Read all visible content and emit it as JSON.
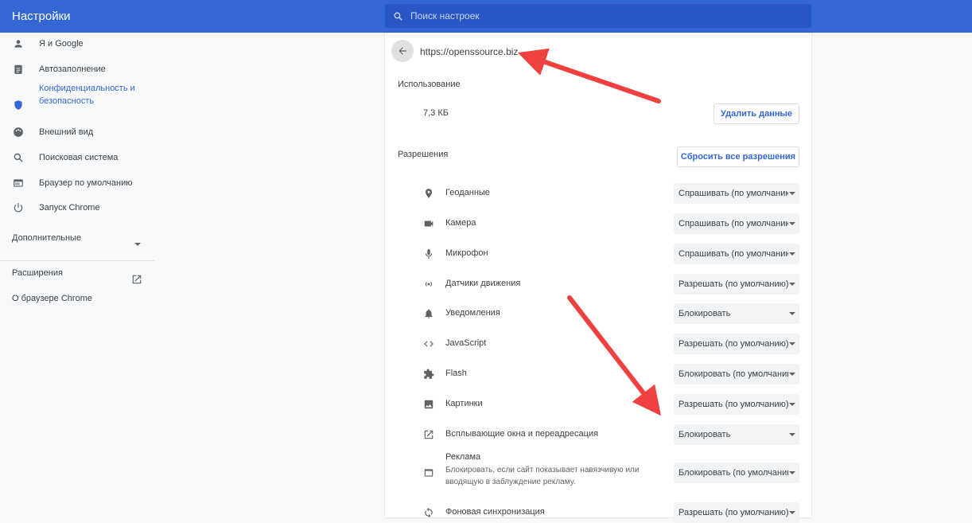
{
  "header": {
    "title": "Настройки",
    "search_placeholder": "Поиск настроек"
  },
  "sidebar": {
    "items": [
      {
        "label": "Я и Google",
        "icon": "person-icon"
      },
      {
        "label": "Автозаполнение",
        "icon": "clipboard-icon"
      },
      {
        "label": "Конфиденциальность и безопасность",
        "icon": "shield-icon",
        "active": true
      },
      {
        "label": "Внешний вид",
        "icon": "palette-icon"
      },
      {
        "label": "Поисковая система",
        "icon": "search-icon"
      },
      {
        "label": "Браузер по умолчанию",
        "icon": "browser-icon"
      },
      {
        "label": "Запуск Chrome",
        "icon": "power-icon"
      }
    ],
    "advanced": "Дополнительные",
    "extensions": "Расширения",
    "about": "О браузере Chrome"
  },
  "site": {
    "url": "https://openssource.biz",
    "usage_title": "Использование",
    "usage_value": "7,3 КБ",
    "delete_button": "Удалить данные",
    "permissions_title": "Разрешения",
    "reset_button": "Сбросить все разрешения"
  },
  "permissions": [
    {
      "label": "Геоданные",
      "value": "Спрашивать (по умолчанию)",
      "icon": "location-icon"
    },
    {
      "label": "Камера",
      "value": "Спрашивать (по умолчанию)",
      "icon": "camera-icon"
    },
    {
      "label": "Микрофон",
      "value": "Спрашивать (по умолчанию)",
      "icon": "microphone-icon"
    },
    {
      "label": "Датчики движения",
      "value": "Разрешать (по умолчанию)",
      "icon": "sensors-icon"
    },
    {
      "label": "Уведомления",
      "value": "Блокировать",
      "icon": "bell-icon"
    },
    {
      "label": "JavaScript",
      "value": "Разрешать (по умолчанию)",
      "icon": "code-icon"
    },
    {
      "label": "Flash",
      "value": "Блокировать (по умолчанию)",
      "icon": "puzzle-icon"
    },
    {
      "label": "Картинки",
      "value": "Разрешать (по умолчанию)",
      "icon": "image-icon"
    },
    {
      "label": "Всплывающие окна и переадресация",
      "value": "Блокировать",
      "icon": "open-in-new-icon"
    },
    {
      "label": "Реклама",
      "sub": "Блокировать, если сайт показывает навязчивую или вводящую в заблуждение рекламу.",
      "value": "Блокировать (по умолчанию)",
      "icon": "ads-icon"
    },
    {
      "label": "Фоновая синхронизация",
      "value": "Разрешать (по умолчанию)",
      "icon": "sync-icon"
    }
  ],
  "colors": {
    "header": "#3367d6",
    "accent": "#3367d6",
    "annotation_arrow": "#f04040"
  }
}
